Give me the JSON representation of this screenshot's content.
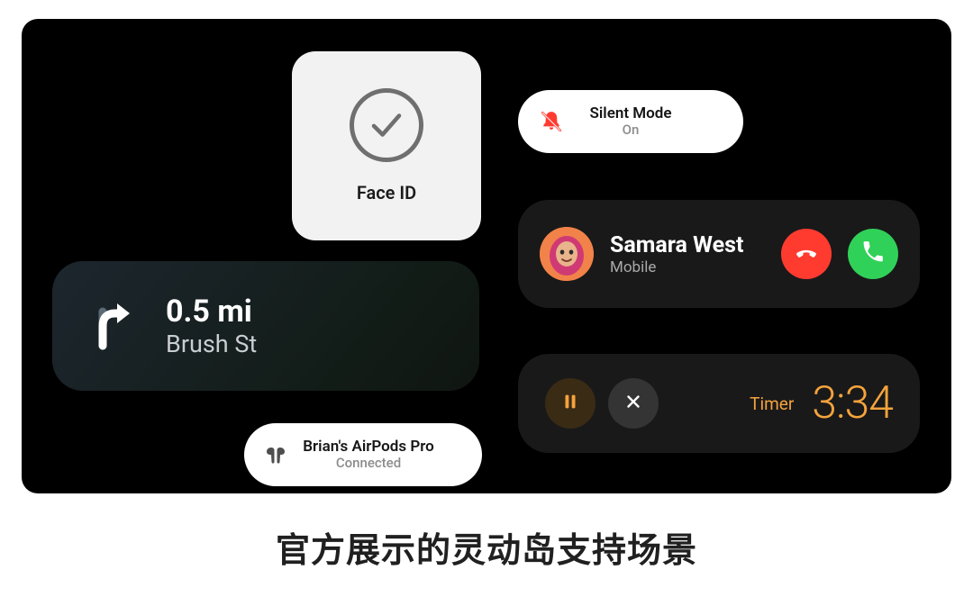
{
  "caption": "官方展示的灵动岛支持场景",
  "faceid": {
    "label": "Face ID"
  },
  "silent": {
    "title": "Silent Mode",
    "status": "On",
    "icon": "bell-slash-icon",
    "icon_color": "#ff3b30"
  },
  "call": {
    "name": "Samara West",
    "line": "Mobile",
    "avatar": "memoji-avatar",
    "decline_color": "#ff3b30",
    "accept_color": "#30d158"
  },
  "nav": {
    "distance": "0.5 mi",
    "street": "Brush St",
    "icon": "turn-right-icon"
  },
  "timer": {
    "label": "Timer",
    "time": "3:34",
    "accent": "#f5a33c"
  },
  "airpods": {
    "title": "Brian's AirPods Pro",
    "status": "Connected",
    "icon": "airpods-icon"
  }
}
